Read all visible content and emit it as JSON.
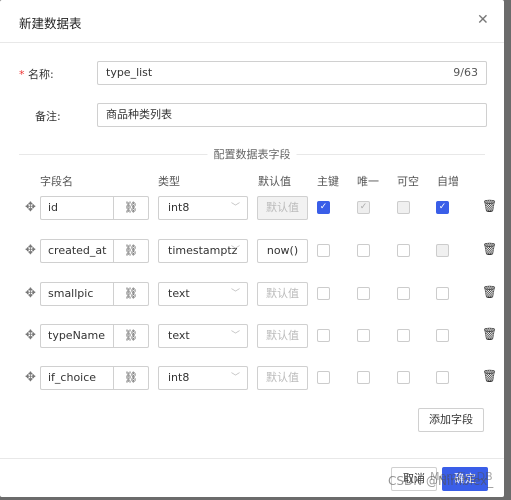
{
  "dialog": {
    "title": "新建数据表",
    "close_icon": "close-icon"
  },
  "form": {
    "name_label": "名称:",
    "name_required": "*",
    "name_value": "type_list",
    "name_count": "9/63",
    "remark_label": "备注:",
    "remark_value": "商品种类列表"
  },
  "section_title": "配置数据表字段",
  "columns": [
    "字段名",
    "类型",
    "默认值",
    "主键",
    "唯一",
    "可空",
    "自增"
  ],
  "default_placeholder": "默认值",
  "rows": [
    {
      "name": "id",
      "type": "int8",
      "default": "",
      "pk": true,
      "unique": true,
      "nullable": false,
      "autoinc": true
    },
    {
      "name": "created_at",
      "type": "timestamptz",
      "default": "now()",
      "pk": false,
      "unique": false,
      "nullable": false,
      "autoinc": false
    },
    {
      "name": "smallpic",
      "type": "text",
      "default": "",
      "pk": false,
      "unique": false,
      "nullable": false,
      "autoinc": false
    },
    {
      "name": "typeName",
      "type": "text",
      "default": "",
      "pk": false,
      "unique": false,
      "nullable": false,
      "autoinc": false
    },
    {
      "name": "if_choice",
      "type": "int8",
      "default": "",
      "pk": false,
      "unique": false,
      "nullable": false,
      "autoinc": false
    }
  ],
  "add_field_label": "添加字段",
  "footer": {
    "cancel_label": "取消",
    "ok_label": "确定"
  },
  "watermark": "CSDN @Nimblex_",
  "watermark2": "MemFireDB",
  "colors": {
    "primary": "#3a5ee8"
  }
}
